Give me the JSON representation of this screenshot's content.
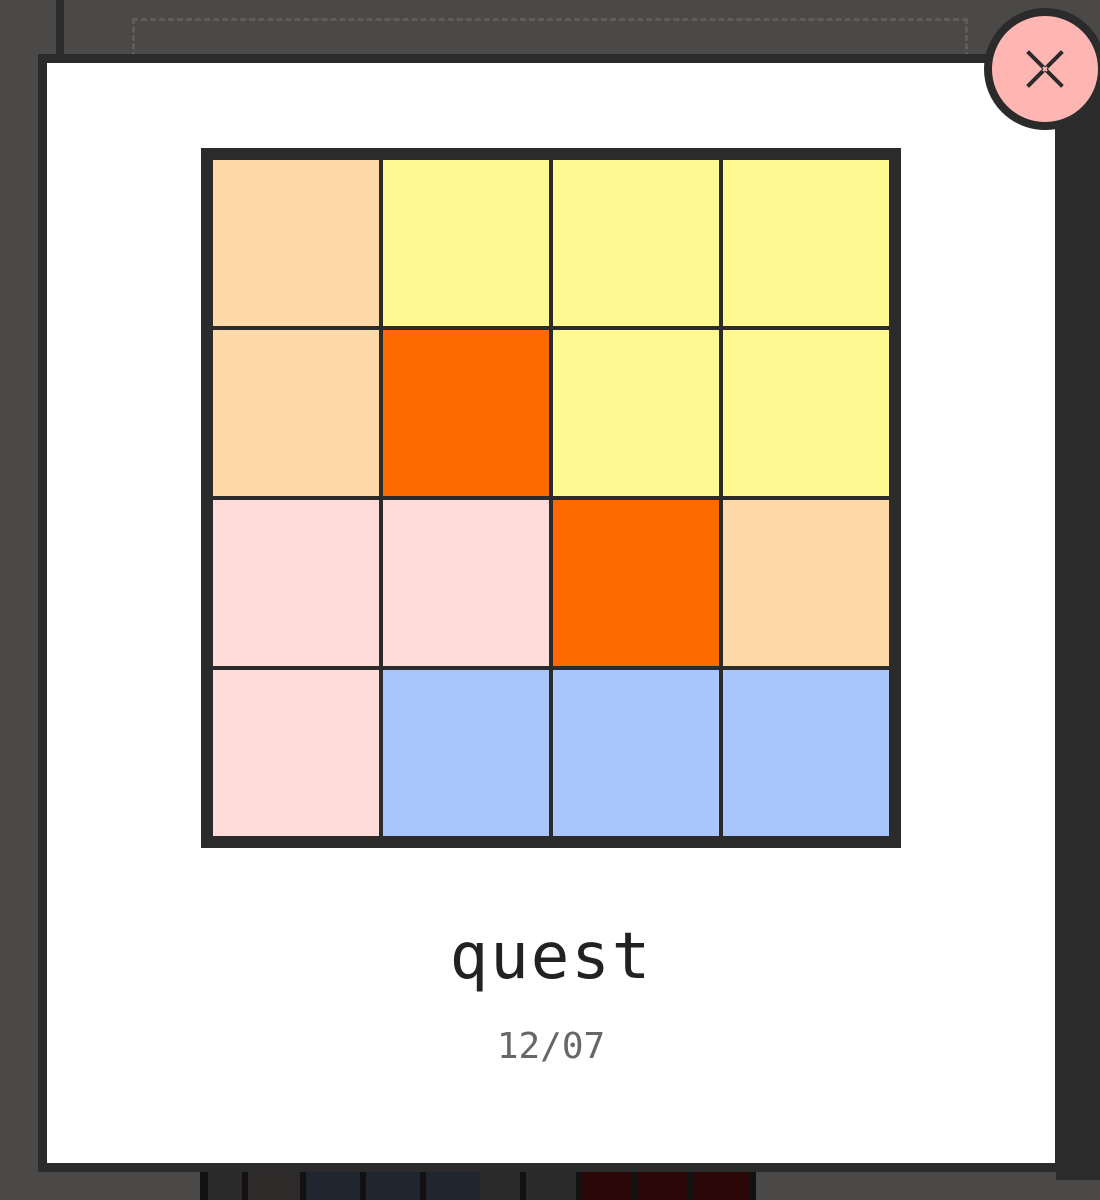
{
  "result": {
    "title": "quest",
    "date": "12/07",
    "grid": [
      [
        "#ffd9a8",
        "#fff991",
        "#fff991",
        "#fff991"
      ],
      [
        "#ffd9a8",
        "#ff6a00",
        "#fff991",
        "#fff991"
      ],
      [
        "#ffdcda",
        "#ffdcda",
        "#ff6a00",
        "#ffd9a8"
      ],
      [
        "#ffdcda",
        "#a8c6fc",
        "#a8c6fc",
        "#a8c6fc"
      ]
    ]
  },
  "close_button": {
    "icon": "close-icon"
  },
  "colors": {
    "border": "#2b2b2b",
    "close_bg": "#ffb6b3",
    "backdrop": "#4a4947"
  }
}
